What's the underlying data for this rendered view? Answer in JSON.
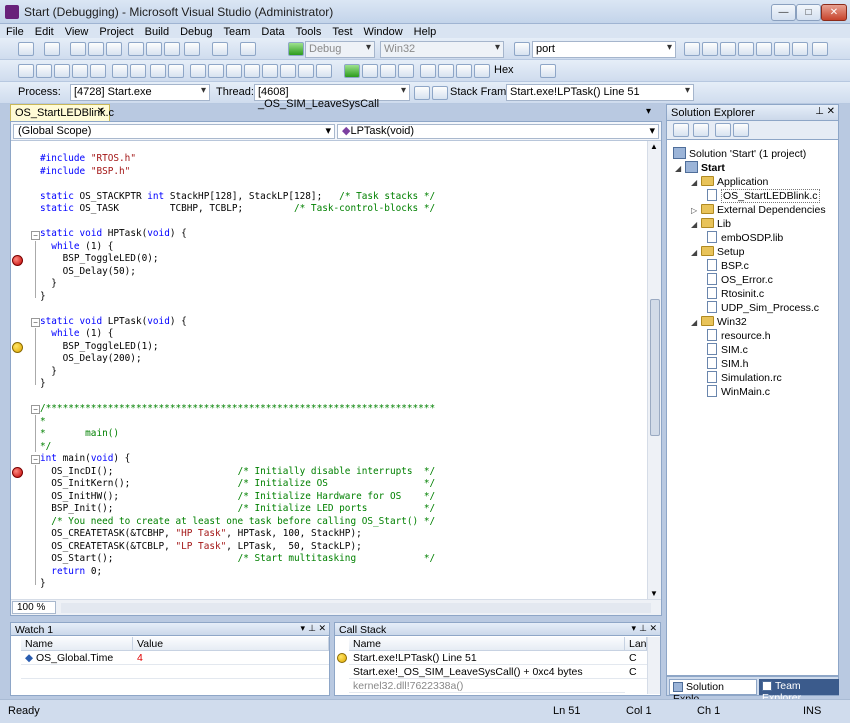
{
  "window": {
    "title": "Start (Debugging) - Microsoft Visual Studio (Administrator)"
  },
  "menu": [
    "File",
    "Edit",
    "View",
    "Project",
    "Build",
    "Debug",
    "Team",
    "Data",
    "Tools",
    "Test",
    "Window",
    "Help"
  ],
  "toolbar1": {
    "config": "Debug",
    "platform": "Win32",
    "find": "port"
  },
  "toolbar2": {
    "hex_label": "Hex"
  },
  "debug_location": {
    "process_label": "Process:",
    "process": "[4728] Start.exe",
    "thread_label": "Thread:",
    "thread": "[4608] _OS_SIM_LeaveSysCall",
    "stackframe_label": "Stack Frame:",
    "stackframe": "Start.exe!LPTask()  Line 51"
  },
  "editor": {
    "tab": "OS_StartLEDBlink.c",
    "scope": "(Global Scope)",
    "function": "LPTask(void)",
    "zoom": "100 %"
  },
  "code_lines": [
    "#include \"RTOS.h\"",
    "#include \"BSP.h\"",
    "",
    "static OS_STACKPTR int StackHP[128], StackLP[128];   /* Task stacks */",
    "static OS_TASK         TCBHP, TCBLP;         /* Task-control-blocks */",
    "",
    "static void HPTask(void) {",
    "  while (1) {",
    "    BSP_ToggleLED(0);",
    "    OS_Delay(50);",
    "  }",
    "}",
    "",
    "static void LPTask(void) {",
    "  while (1) {",
    "    BSP_ToggleLED(1);",
    "    OS_Delay(200);",
    "  }",
    "}",
    "",
    "/*********************************************************************",
    "*",
    "*       main()",
    "*/",
    "int main(void) {",
    "  OS_IncDI();                      /* Initially disable interrupts  */",
    "  OS_InitKern();                   /* Initialize OS                 */",
    "  OS_InitHW();                     /* Initialize Hardware for OS    */",
    "  BSP_Init();                      /* Initialize LED ports          */",
    "  /* You need to create at least one task before calling OS_Start() */",
    "  OS_CREATETASK(&TCBHP, \"HP Task\", HPTask, 100, StackHP);",
    "  OS_CREATETASK(&TCBLP, \"LP Task\", LPTask,  50, StackLP);",
    "  OS_Start();                      /* Start multitasking            */",
    "  return 0;",
    "}"
  ],
  "solution_explorer": {
    "title": "Solution Explorer",
    "items": [
      {
        "label": "Solution 'Start' (1 project)",
        "type": "solution"
      },
      {
        "label": "Start",
        "type": "project"
      },
      {
        "label": "Application",
        "type": "folder"
      },
      {
        "label": "OS_StartLEDBlink.c",
        "type": "file"
      },
      {
        "label": "External Dependencies",
        "type": "folder"
      },
      {
        "label": "Lib",
        "type": "folder"
      },
      {
        "label": "embOSDP.lib",
        "type": "file"
      },
      {
        "label": "Setup",
        "type": "folder"
      },
      {
        "label": "BSP.c",
        "type": "file"
      },
      {
        "label": "OS_Error.c",
        "type": "file"
      },
      {
        "label": "Rtosinit.c",
        "type": "file"
      },
      {
        "label": "UDP_Sim_Process.c",
        "type": "file"
      },
      {
        "label": "Win32",
        "type": "folder"
      },
      {
        "label": "resource.h",
        "type": "file"
      },
      {
        "label": "SIM.c",
        "type": "file"
      },
      {
        "label": "SIM.h",
        "type": "file"
      },
      {
        "label": "Simulation.rc",
        "type": "file"
      },
      {
        "label": "WinMain.c",
        "type": "file"
      }
    ],
    "tabs": [
      "Solution Explo...",
      "Team Explorer"
    ]
  },
  "watch": {
    "title": "Watch 1",
    "columns": [
      "Name",
      "Value"
    ],
    "rows": [
      {
        "name": "OS_Global.Time",
        "value": "4"
      }
    ]
  },
  "callstack": {
    "title": "Call Stack",
    "columns": [
      "Name",
      "Lang"
    ],
    "rows": [
      {
        "name": "Start.exe!LPTask()  Line 51",
        "lang": "C"
      },
      {
        "name": "Start.exe!_OS_SIM_LeaveSysCall()  + 0xc4 bytes",
        "lang": "C"
      },
      {
        "name": "kernel32.dll!7622338a()",
        "lang": ""
      }
    ]
  },
  "status": {
    "text": "Ready",
    "ln": "Ln 51",
    "col": "Col 1",
    "ch": "Ch 1",
    "mode": "INS"
  }
}
